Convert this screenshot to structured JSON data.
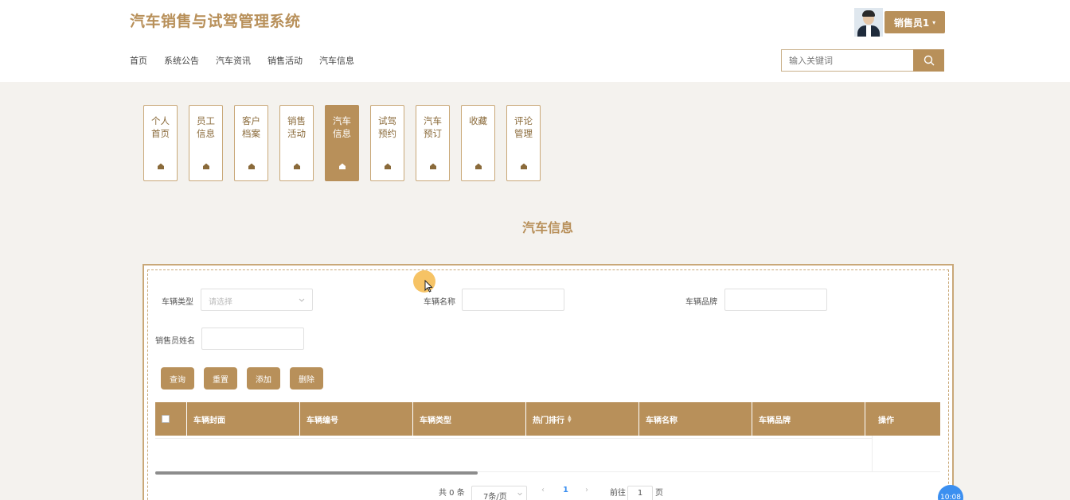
{
  "app": {
    "title": "汽车销售与试驾管理系统"
  },
  "nav": [
    "首页",
    "系统公告",
    "汽车资讯",
    "销售活动",
    "汽车信息"
  ],
  "user": {
    "name": "销售员1"
  },
  "search": {
    "placeholder": "输入关键词"
  },
  "tiles": [
    {
      "line1": "个人",
      "line2": "首页"
    },
    {
      "line1": "员工",
      "line2": "信息"
    },
    {
      "line1": "客户",
      "line2": "档案"
    },
    {
      "line1": "销售",
      "line2": "活动"
    },
    {
      "line1": "汽车",
      "line2": "信息",
      "active": true
    },
    {
      "line1": "试驾",
      "line2": "预约"
    },
    {
      "line1": "汽车",
      "line2": "预订"
    },
    {
      "line1": "收藏",
      "line2": ""
    },
    {
      "line1": "评论",
      "line2": "管理"
    }
  ],
  "page_title": "汽车信息",
  "filters": {
    "vehicle_type_label": "车辆类型",
    "vehicle_type_placeholder": "请选择",
    "vehicle_name_label": "车辆名称",
    "vehicle_brand_label": "车辆品牌",
    "salesperson_label": "销售员姓名"
  },
  "actions": {
    "query": "查询",
    "reset": "重置",
    "add": "添加",
    "delete": "删除"
  },
  "table": {
    "columns": [
      "车辆封面",
      "车辆编号",
      "车辆类型",
      "热门排行",
      "车辆名称",
      "车辆品牌",
      "操作"
    ]
  },
  "pagination": {
    "total": "共 0 条",
    "page_size": "7条/页",
    "current_page": "1",
    "goto_label": "前往",
    "goto_value": "1",
    "page_suffix": "页"
  },
  "float_button": {
    "time": "10:08"
  },
  "colors": {
    "accent": "#b8905a",
    "float": "#3b8ff0"
  }
}
